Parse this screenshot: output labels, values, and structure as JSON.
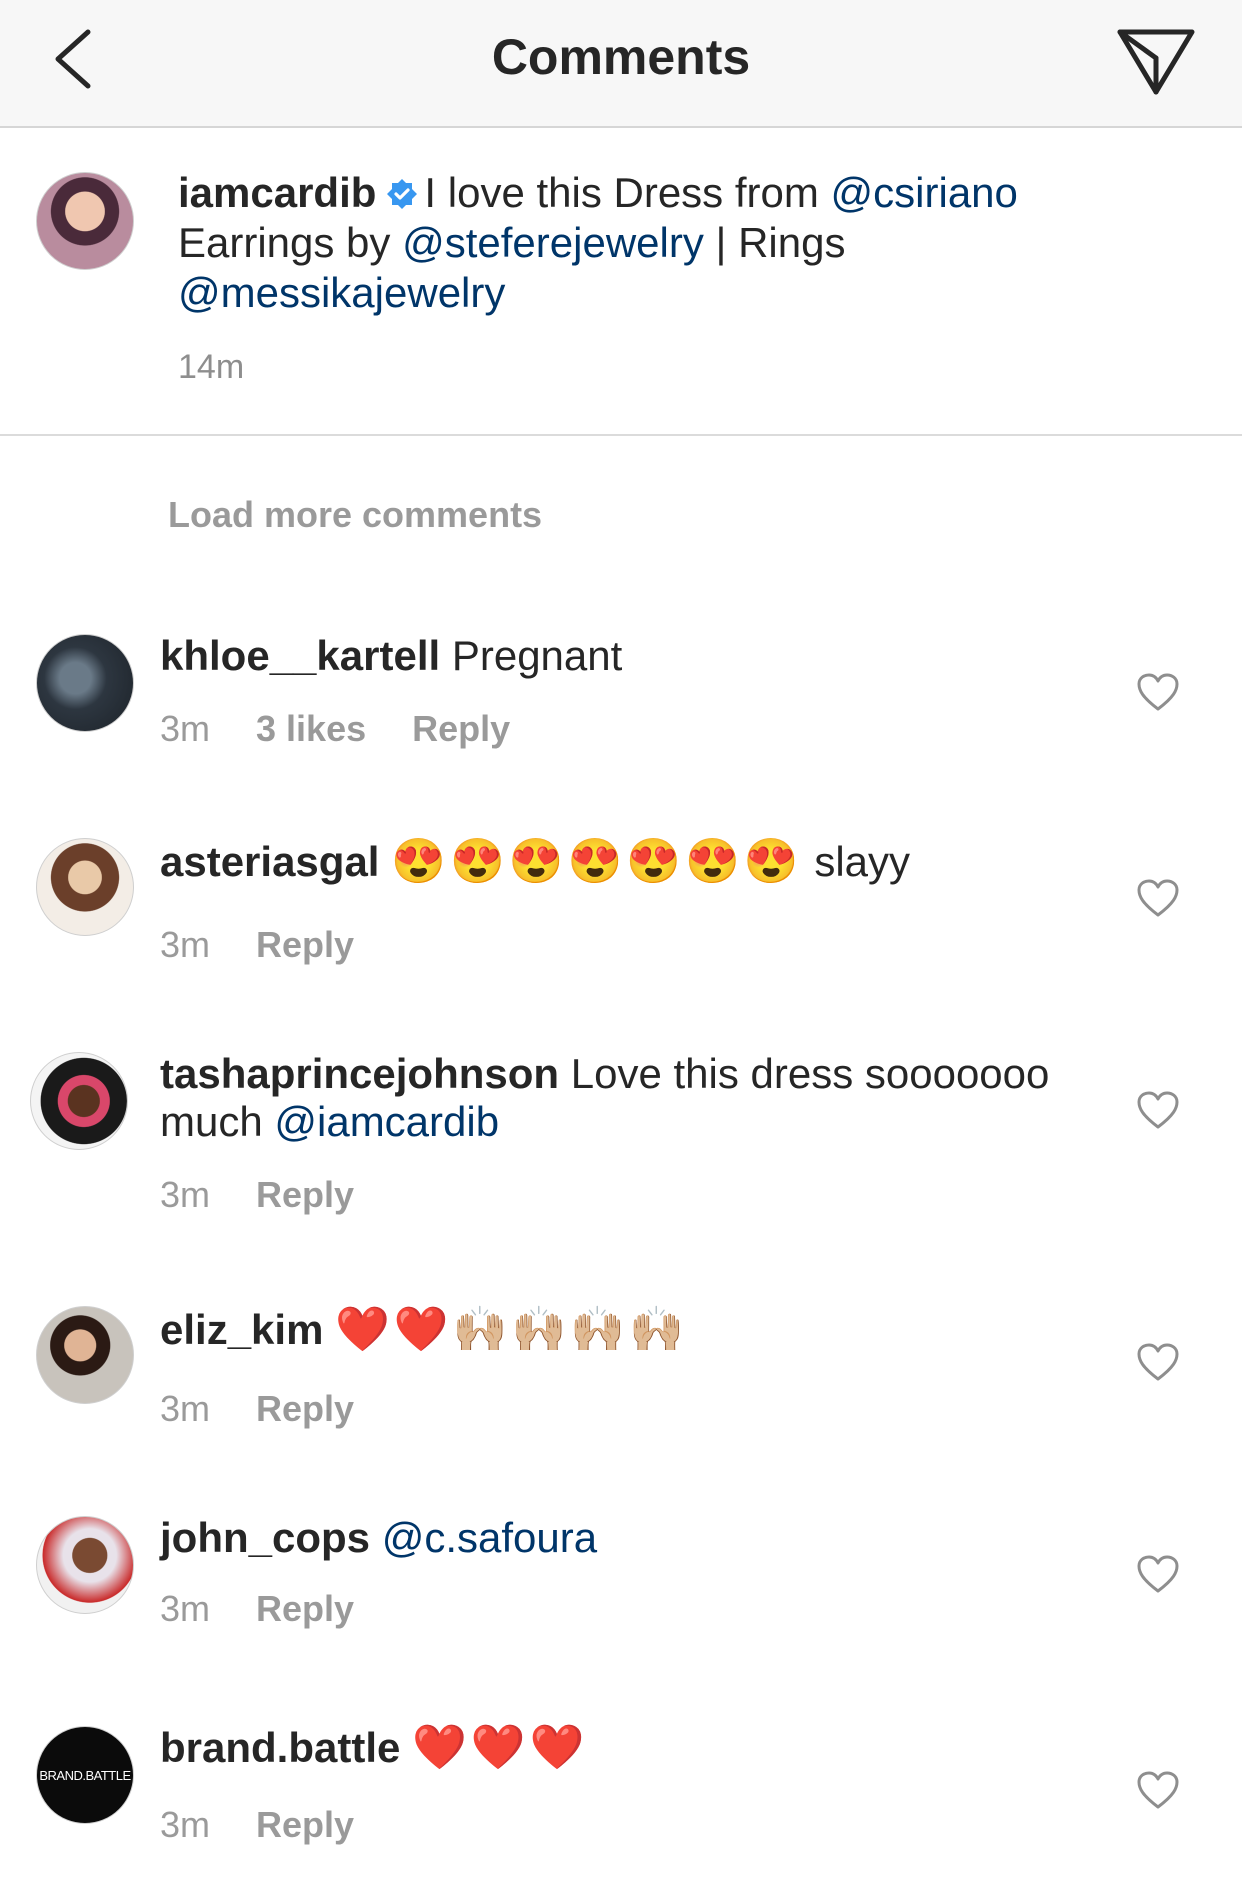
{
  "header": {
    "title": "Comments"
  },
  "caption": {
    "username": "iamcardib",
    "text_1": "I love this Dress from",
    "mention_1": "@csiriano",
    "text_2": "Earrings by",
    "mention_2": "@steferejewelry",
    "text_3": "| Rings",
    "mention_3": "@messikajewelry",
    "time": "14m"
  },
  "load_more": "Load more comments",
  "comments": [
    {
      "username": "khloe__kartell",
      "text": "Pregnant",
      "time": "3m",
      "likes": "3 likes",
      "reply": "Reply"
    },
    {
      "username": "asteriasgal",
      "emoji": "😍😍😍😍😍😍😍",
      "text": "slayy",
      "time": "3m",
      "reply": "Reply"
    },
    {
      "username": "tashaprincejohnson",
      "text": "Love this dress sooooooo much",
      "mention": "@iamcardib",
      "time": "3m",
      "reply": "Reply"
    },
    {
      "username": "eliz_kim",
      "emoji": "❤️❤️🙌🏼🙌🏼🙌🏼🙌🏼",
      "time": "3m",
      "reply": "Reply"
    },
    {
      "username": "john_cops",
      "mention": "@c.safoura",
      "time": "3m",
      "reply": "Reply"
    },
    {
      "username": "brand.battle",
      "emoji": "❤️❤️❤️",
      "time": "3m",
      "reply": "Reply",
      "avatar_text": "BRAND.BATTLE"
    }
  ],
  "colors": {
    "mention": "#003569",
    "meta": "#9a9a9a",
    "verified": "#3897f0"
  }
}
